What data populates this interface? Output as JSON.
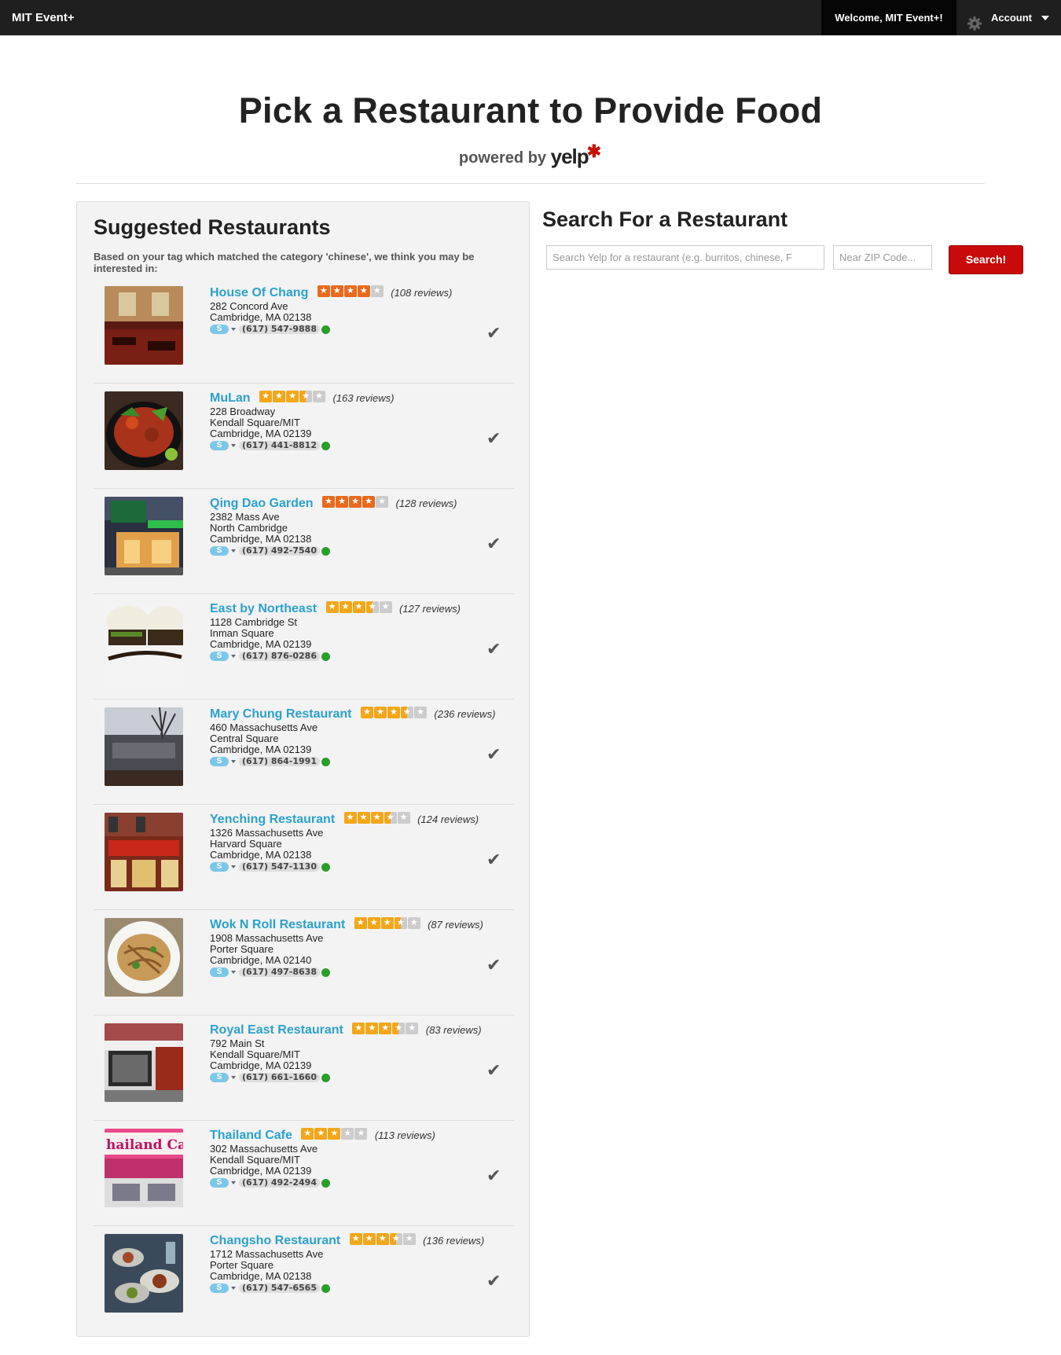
{
  "nav": {
    "brand": "MIT Event+",
    "welcome": "Welcome, MIT Event+!",
    "account": "Account"
  },
  "header": {
    "title": "Pick a Restaurant to Provide Food",
    "powered_by": "powered by",
    "yelp": "yelp"
  },
  "suggested": {
    "title": "Suggested Restaurants",
    "intro": "Based on your tag which matched the category 'chinese', we think you may be interested in:",
    "restaurants": [
      {
        "name": "House Of Chang",
        "rating": 4,
        "star_color": "#e86a1e",
        "reviews": "(108 reviews)",
        "address": [
          "282 Concord Ave",
          "Cambridge, MA 02138"
        ],
        "phone": "(617) 547-9888"
      },
      {
        "name": "MuLan",
        "rating": 3.5,
        "star_color": "#f2a71a",
        "reviews": "(163 reviews)",
        "address": [
          "228 Broadway",
          "Kendall Square/MIT",
          "Cambridge, MA 02139"
        ],
        "phone": "(617) 441-8812"
      },
      {
        "name": "Qing Dao Garden",
        "rating": 4,
        "star_color": "#e86a1e",
        "reviews": "(128 reviews)",
        "address": [
          "2382 Mass Ave",
          "North Cambridge",
          "Cambridge, MA 02138"
        ],
        "phone": "(617) 492-7540"
      },
      {
        "name": "East by Northeast",
        "rating": 3.5,
        "star_color": "#f2a71a",
        "reviews": "(127 reviews)",
        "address": [
          "1128 Cambridge St",
          "Inman Square",
          "Cambridge, MA 02139"
        ],
        "phone": "(617) 876-0286"
      },
      {
        "name": "Mary Chung Restaurant",
        "rating": 3.5,
        "star_color": "#f2a71a",
        "reviews": "(236 reviews)",
        "address": [
          "460 Massachusetts Ave",
          "Central Square",
          "Cambridge, MA 02139"
        ],
        "phone": "(617) 864-1991"
      },
      {
        "name": "Yenching Restaurant",
        "rating": 3.5,
        "star_color": "#f2a71a",
        "reviews": "(124 reviews)",
        "address": [
          "1326 Massachusetts Ave",
          "Harvard Square",
          "Cambridge, MA 02138"
        ],
        "phone": "(617) 547-1130"
      },
      {
        "name": "Wok N Roll Restaurant",
        "rating": 3.5,
        "star_color": "#f2a71a",
        "reviews": "(87 reviews)",
        "address": [
          "1908 Massachusetts Ave",
          "Porter Square",
          "Cambridge, MA 02140"
        ],
        "phone": "(617) 497-8638"
      },
      {
        "name": "Royal East Restaurant",
        "rating": 3.5,
        "star_color": "#f2a71a",
        "reviews": "(83 reviews)",
        "address": [
          "792 Main St",
          "Kendall Square/MIT",
          "Cambridge, MA 02139"
        ],
        "phone": "(617) 661-1660"
      },
      {
        "name": "Thailand Cafe",
        "rating": 3,
        "star_color": "#f2a71a",
        "reviews": "(113 reviews)",
        "address": [
          "302 Massachusetts Ave",
          "Kendall Square/MIT",
          "Cambridge, MA 02139"
        ],
        "phone": "(617) 492-2494"
      },
      {
        "name": "Changsho Restaurant",
        "rating": 3.5,
        "star_color": "#f2a71a",
        "reviews": "(136 reviews)",
        "address": [
          "1712 Massachusetts Ave",
          "Porter Square",
          "Cambridge, MA 02138"
        ],
        "phone": "(617) 547-6565"
      }
    ]
  },
  "search": {
    "title": "Search For a Restaurant",
    "query_placeholder": "Search Yelp for a restaurant (e.g. burritos, chinese, F",
    "zip_placeholder": "Near ZIP Code...",
    "button": "Search!"
  },
  "icons": {
    "gear": "gear-icon",
    "caret": "chevron-down-icon",
    "check": "checkmark-icon",
    "skype": "skype-icon",
    "call": "phone-call-icon",
    "yelp_burst": "yelp-burst-icon"
  },
  "colors": {
    "nav_bg": "#1f1f1f",
    "link": "#2ba1cc",
    "search_button": "#c80a0a"
  }
}
